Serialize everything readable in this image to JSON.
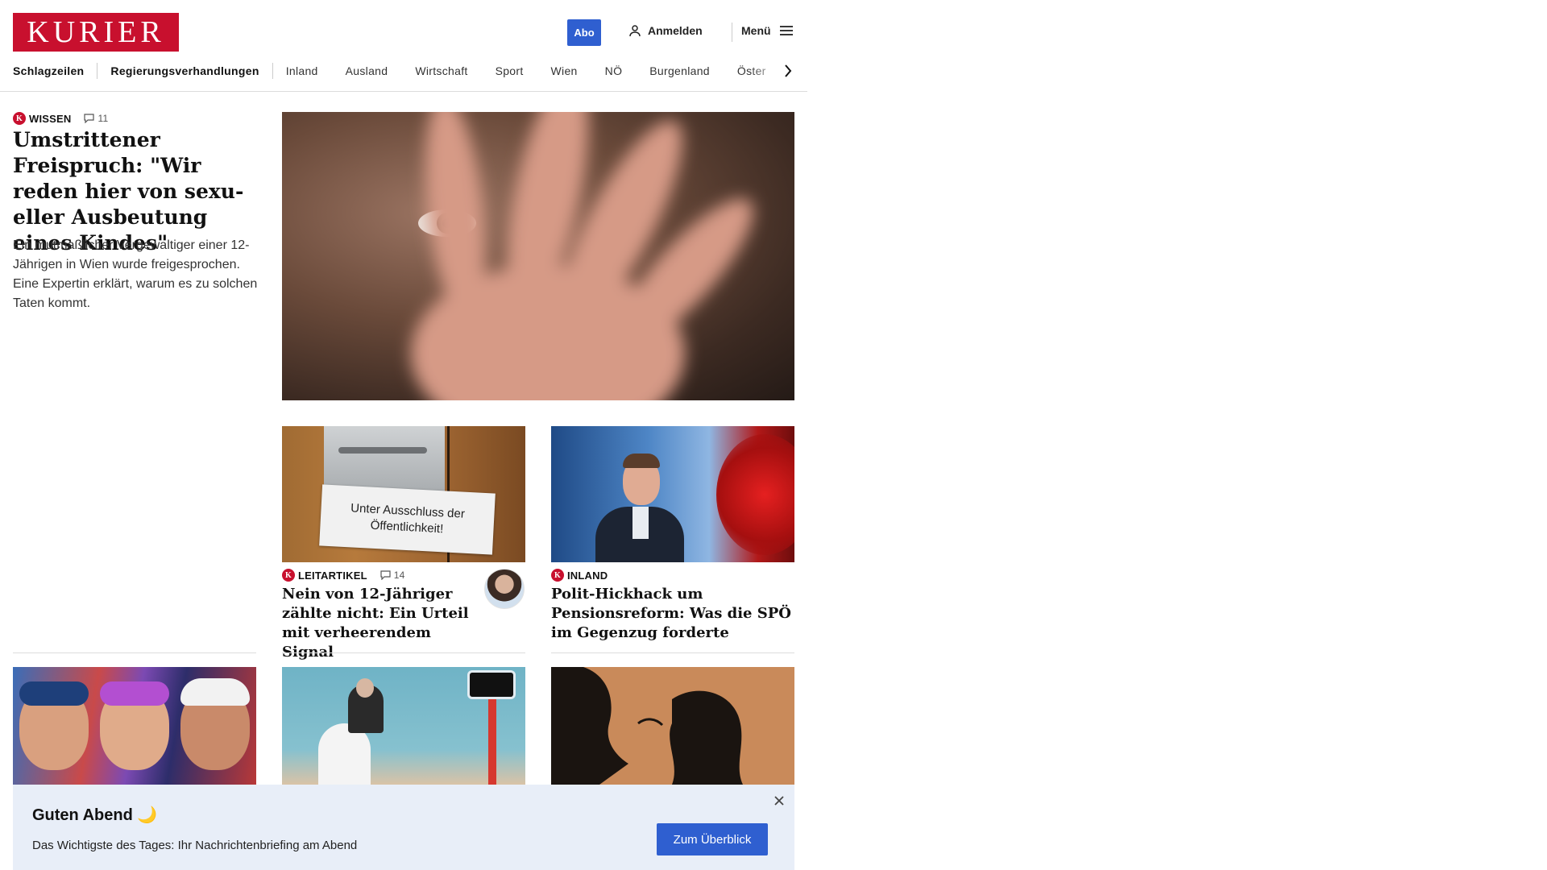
{
  "header": {
    "logo": "KURIER",
    "abo_label": "Abo",
    "login_label": "Anmelden",
    "menu_label": "Menü"
  },
  "nav": {
    "items": [
      "Schlagzeilen",
      "Regierungsverhandlungen",
      "Inland",
      "Ausland",
      "Wirtschaft",
      "Sport",
      "Wien",
      "NÖ",
      "Burgenland",
      "Öster"
    ]
  },
  "lead": {
    "badge": "K",
    "category": "WISSEN",
    "comments": "11",
    "title": "Umstrittener Freispruch: \"Wir reden hier von sexu­eller Ausbeutung eines Kindes\"",
    "teaser": "Ein mutmaßlicher Vergewaltiger einer 12-Jährigen in Wien wurde freigesprochen. Eine Expertin erklärt, warum es zu solchen Taten kommt."
  },
  "teasers": [
    {
      "badge": "K",
      "category": "LEITARTIKEL",
      "comments": "14",
      "title": "Nein von 12-Jähriger zählte nicht: Ein Urteil mit verheerendem Signal",
      "image_text": "Unter Ausschluss der Öffentlichkeit!"
    },
    {
      "badge": "K",
      "category": "INLAND",
      "title": "Polit-Hickhack um Pensionsre­form: Was die SPÖ im Gegenzug forderte"
    }
  ],
  "banner": {
    "title": "Guten Abend 🌙",
    "text": "Das Wichtigste des Tages: Ihr Nachrichtenbriefing am Abend",
    "button": "Zum Überblick"
  },
  "colors": {
    "brand_red": "#c8102e",
    "accent_blue": "#2f5fd0",
    "banner_bg": "#e8eef8"
  }
}
